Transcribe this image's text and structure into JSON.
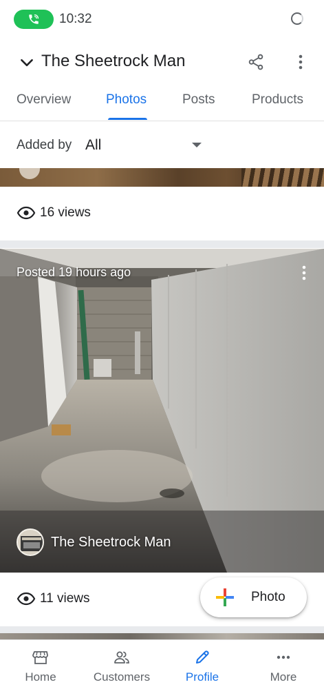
{
  "status_bar": {
    "time": "10:32",
    "call_icon": "phone-in-call-icon",
    "sync_icon": "loading-spinner-icon",
    "call_pill_color": "#1fc157"
  },
  "header": {
    "title": "The Sheetrock Man",
    "back_icon": "chevron-down-icon",
    "share_icon": "share-icon",
    "menu_icon": "more-vert-icon"
  },
  "tabs": [
    {
      "label": "Overview",
      "active": false
    },
    {
      "label": "Photos",
      "active": true
    },
    {
      "label": "Posts",
      "active": false
    },
    {
      "label": "Products",
      "active": false
    }
  ],
  "filter": {
    "label": "Added by",
    "value": "All",
    "caret_icon": "dropdown-caret-icon"
  },
  "feed": {
    "previous_card": {
      "views": "16 views"
    },
    "photo_card": {
      "posted": "Posted 19 hours ago",
      "author": "The Sheetrock Man",
      "views": "11 views",
      "menu_icon": "more-vert-icon"
    }
  },
  "fab": {
    "label": "Photo",
    "icon": "plus-multicolor-icon"
  },
  "bottom_nav": [
    {
      "label": "Home",
      "icon": "storefront-icon",
      "active": false
    },
    {
      "label": "Customers",
      "icon": "people-icon",
      "active": false
    },
    {
      "label": "Profile",
      "icon": "pencil-icon",
      "active": true
    },
    {
      "label": "More",
      "icon": "more-horiz-icon",
      "active": false
    }
  ],
  "colors": {
    "accent": "#1a73e8",
    "text_primary": "#202124",
    "text_secondary": "#5f6368",
    "separator": "#e8eaed"
  }
}
